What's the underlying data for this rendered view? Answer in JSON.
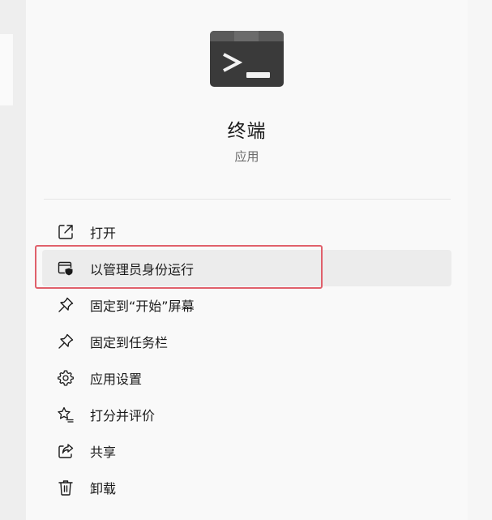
{
  "app": {
    "name": "终端",
    "type": "应用",
    "icon": "terminal-icon"
  },
  "menu": {
    "items": [
      {
        "label": "打开",
        "icon": "open-external-icon"
      },
      {
        "label": "以管理员身份运行",
        "icon": "admin-shield-icon",
        "hovered": true,
        "highlighted": true
      },
      {
        "label": "固定到“开始”屏幕",
        "icon": "pin-icon"
      },
      {
        "label": "固定到任务栏",
        "icon": "pin-icon"
      },
      {
        "label": "应用设置",
        "icon": "gear-icon"
      },
      {
        "label": "打分并评价",
        "icon": "rate-review-icon"
      },
      {
        "label": "共享",
        "icon": "share-icon"
      },
      {
        "label": "卸载",
        "icon": "trash-icon"
      }
    ]
  },
  "colors": {
    "highlight_border": "#e0606b",
    "hover_background": "#ececec",
    "panel_background": "#f9f9f9"
  }
}
